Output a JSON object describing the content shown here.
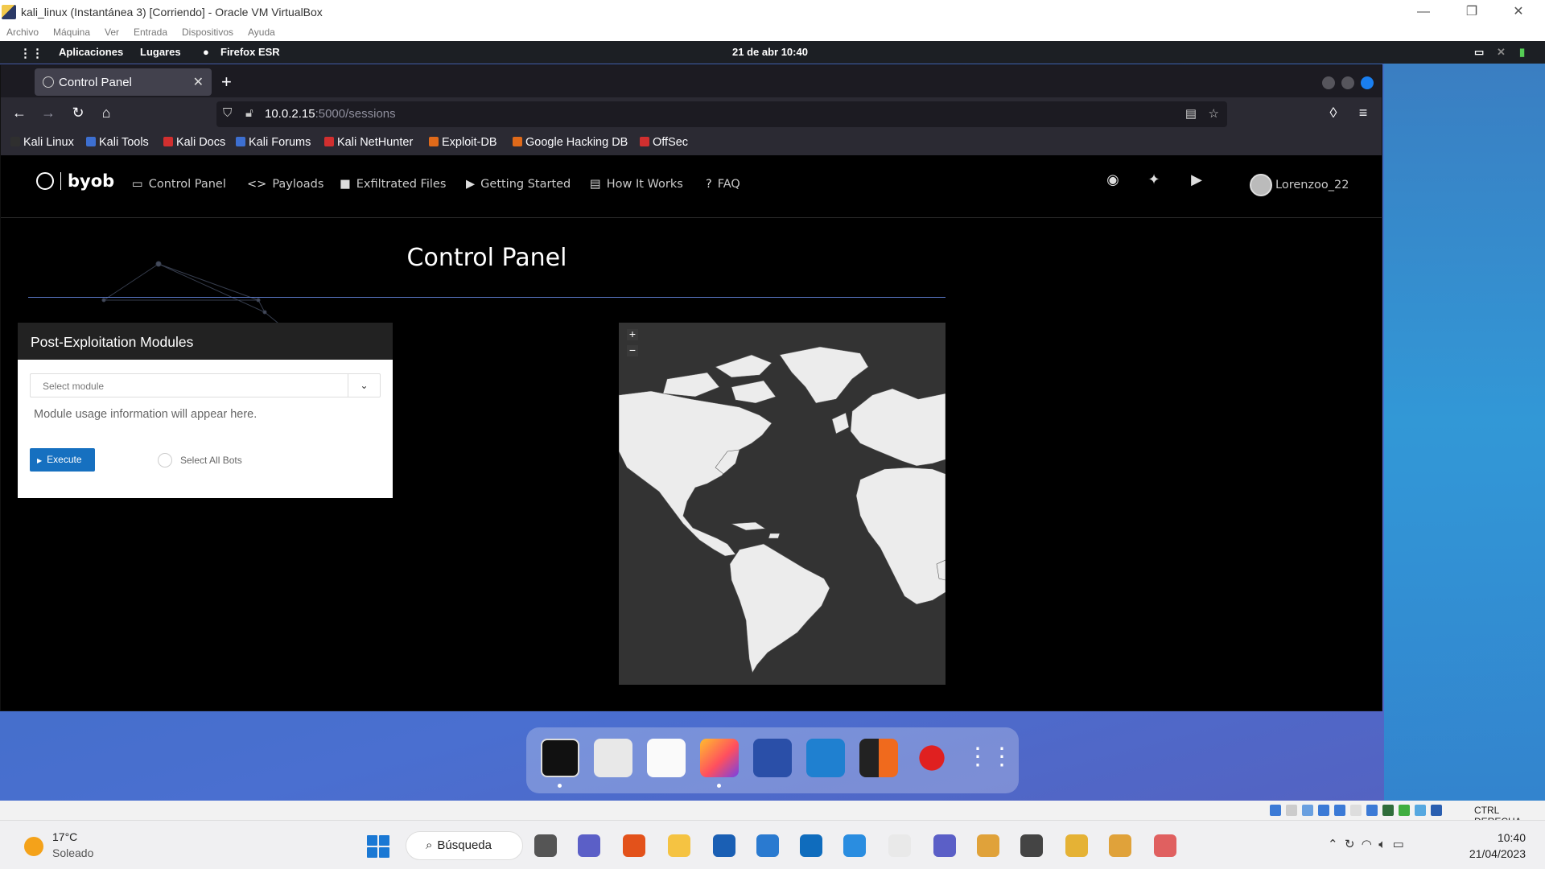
{
  "vbox": {
    "title": "kali_linux (Instantánea 3) [Corriendo] - Oracle VM VirtualBox",
    "menu": [
      "Archivo",
      "Máquina",
      "Ver",
      "Entrada",
      "Dispositivos",
      "Ayuda"
    ],
    "host_key": "CTRL DERECHA"
  },
  "kali": {
    "apps": "Aplicaciones",
    "places": "Lugares",
    "active_app": "Firefox ESR",
    "clock": "21 de abr  10:40"
  },
  "firefox": {
    "tab_title": "Control Panel",
    "url_host": "10.0.2.15",
    "url_path": ":5000/sessions",
    "bookmarks": [
      {
        "label": "Kali Linux",
        "color": "#2f2f2f"
      },
      {
        "label": "Kali Tools",
        "color": "#3d6fd1"
      },
      {
        "label": "Kali Docs",
        "color": "#d12f2f"
      },
      {
        "label": "Kali Forums",
        "color": "#3d6fd1"
      },
      {
        "label": "Kali NetHunter",
        "color": "#d12f2f"
      },
      {
        "label": "Exploit-DB",
        "color": "#e06a1a"
      },
      {
        "label": "Google Hacking DB",
        "color": "#e06a1a"
      },
      {
        "label": "OffSec",
        "color": "#d12f2f"
      }
    ]
  },
  "byob": {
    "brand": "byob",
    "nav": [
      {
        "label": "Control Panel",
        "icon": "▭"
      },
      {
        "label": "Payloads",
        "icon": "<>"
      },
      {
        "label": "Exfiltrated Files",
        "icon": "■"
      },
      {
        "label": "Getting Started",
        "icon": "▶"
      },
      {
        "label": "How It Works",
        "icon": "▤"
      },
      {
        "label": "FAQ",
        "icon": "?"
      }
    ],
    "user": "Lorenzoo_22",
    "page_title": "Control Panel",
    "modules_card": {
      "title": "Post-Exploitation Modules",
      "select_placeholder": "Select module",
      "info": "Module usage information will appear here.",
      "execute": "Execute",
      "select_all": "Select All Bots"
    },
    "map": {
      "zoom_in": "+",
      "zoom_out": "−"
    }
  },
  "windows": {
    "weather_temp": "17°C",
    "weather_cond": "Soleado",
    "search": "Búsqueda",
    "time": "10:40",
    "date": "21/04/2023"
  }
}
